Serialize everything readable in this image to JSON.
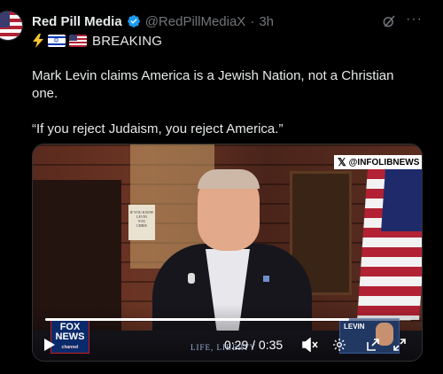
{
  "post": {
    "author": {
      "display_name": "Red Pill Media",
      "handle": "@RedPillMediaX",
      "separator": "·",
      "time": "3h",
      "verified": true,
      "avatar": "us-flag-avatar"
    },
    "tagline": {
      "icons": [
        "lightning-bolt",
        "israel-flag",
        "us-flag"
      ],
      "text": "BREAKING"
    },
    "body": {
      "paragraph_1": "Mark Levin claims America is a Jewish Nation, not a Christian one.",
      "paragraph_2": "“If you reject Judaism, you reject America.”"
    },
    "actions": {
      "grok_icon": "grok-icon",
      "more_icon": "more-icon",
      "more_glyph": "···"
    }
  },
  "video": {
    "watermark": "@INFOLIBNEWS",
    "watermark_glyph": "𝕏",
    "sign_text": "IF YOU KNOW LEVIN\nYOU\nCHRIS",
    "channel_logo": "FOX NEWS",
    "channel_logo_line1": "FOX",
    "channel_logo_line2": "NEWS",
    "channel_logo_sub": "channel",
    "lower_third": "LIFE, LIBERTY",
    "pip_label": "LEVIN",
    "current_time": "0:29",
    "duration": "0:35",
    "time_readout": "0:29 / 0:35",
    "progress_fraction": 0.83,
    "controls": [
      "play-icon",
      "volume-icon",
      "settings-icon",
      "pip-icon",
      "fullscreen-icon"
    ]
  },
  "colors": {
    "background": "#000000",
    "text_primary": "#e7e9ea",
    "text_secondary": "#71767b",
    "verified_blue": "#1d9bf0"
  }
}
